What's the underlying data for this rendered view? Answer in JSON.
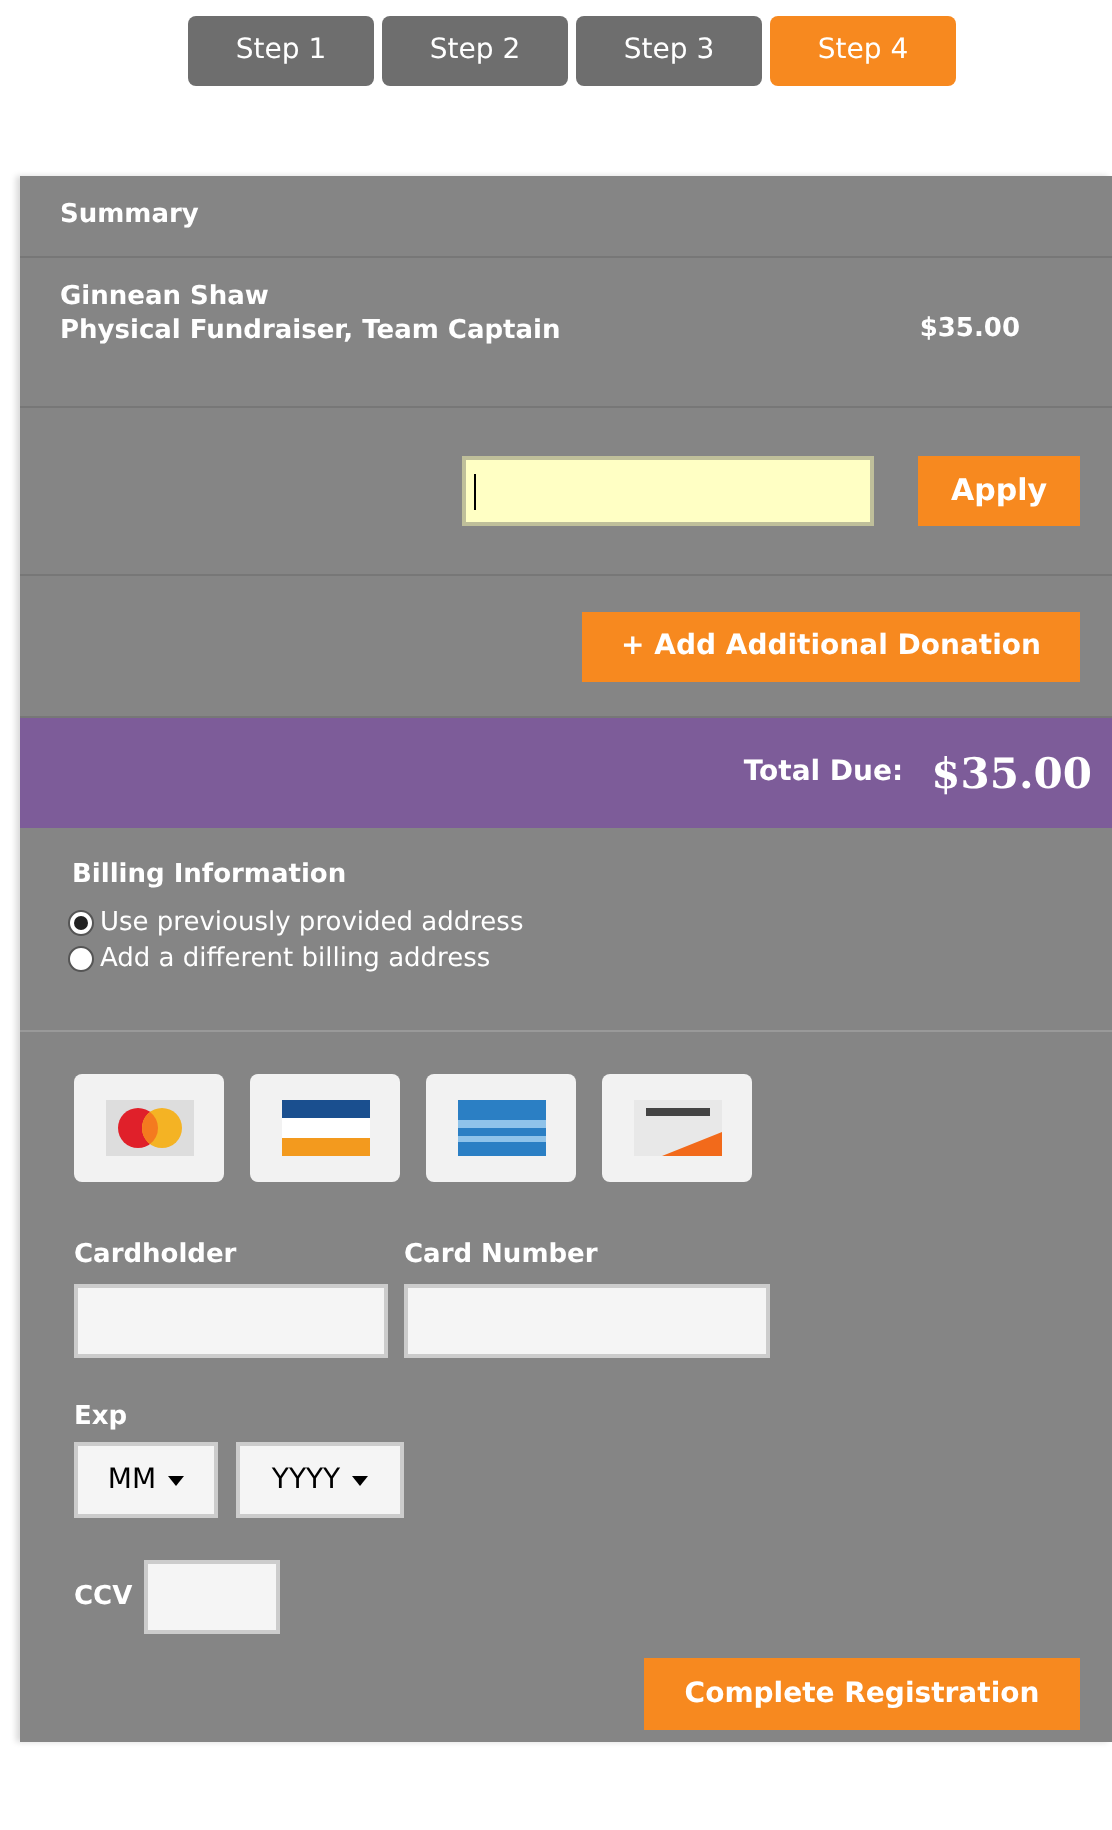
{
  "steps": [
    {
      "label": "Step 1",
      "selected": false
    },
    {
      "label": "Step 2",
      "selected": false
    },
    {
      "label": "Step 3",
      "selected": false
    },
    {
      "label": "Step 4",
      "selected": true
    }
  ],
  "summary": {
    "title": "Summary",
    "items": [
      {
        "name": "Ginnean Shaw",
        "description": "Physical Fundraiser, Team Captain",
        "amount": "$35.00"
      }
    ]
  },
  "promo": {
    "focused": true,
    "button": "Apply"
  },
  "donation_button": "+ Add Additional Donation",
  "total": {
    "label": "Total Due:",
    "amount": "$35.00"
  },
  "billing": {
    "title": "Billing Information",
    "options": [
      {
        "label": "Use previously provided address",
        "selected": true
      },
      {
        "label": "Add a different billing address",
        "selected": false
      }
    ]
  },
  "card_logos": [
    {
      "kind": "mastercard"
    },
    {
      "kind": "visa"
    },
    {
      "kind": "amex"
    },
    {
      "kind": "discover"
    }
  ],
  "payment": {
    "cardholder_label": "Cardholder",
    "card_number_label": "Card Number",
    "exp_label": "Exp",
    "month": "MM",
    "year": "YYYY",
    "ccv_label": "CCV",
    "submit": "Complete Registration"
  }
}
